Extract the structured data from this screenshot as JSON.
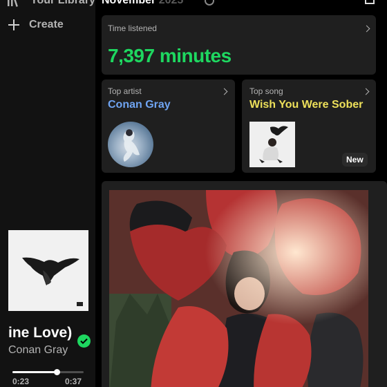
{
  "sidebar": {
    "library_label": "Your Library",
    "create_label": "Create",
    "icons": {
      "library": "library-icon",
      "create": "plus-icon"
    }
  },
  "now_playing": {
    "title": "ine Love)",
    "artist": "Conan Gray",
    "elapsed": "0:23",
    "duration": "0:37",
    "progress_fraction": 0.62,
    "saved": true,
    "saved_icon": "check-circle-icon"
  },
  "header": {
    "month": "November",
    "year": "2025",
    "icons": {
      "info": "info-icon",
      "share": "share-icon"
    }
  },
  "cards": {
    "time_listened": {
      "label": "Time listened",
      "value": "7,397 minutes"
    },
    "top_artist": {
      "label": "Top artist",
      "name": "Conan Gray"
    },
    "top_song": {
      "label": "Top song",
      "name": "Wish You Were Sober",
      "badge": "New"
    }
  },
  "colors": {
    "accent_green": "#1ed760",
    "artist_blue": "#6fa4f2",
    "song_yellow": "#ede05a",
    "card_bg": "#1f1f1f",
    "sidebar_bg": "#121212"
  }
}
